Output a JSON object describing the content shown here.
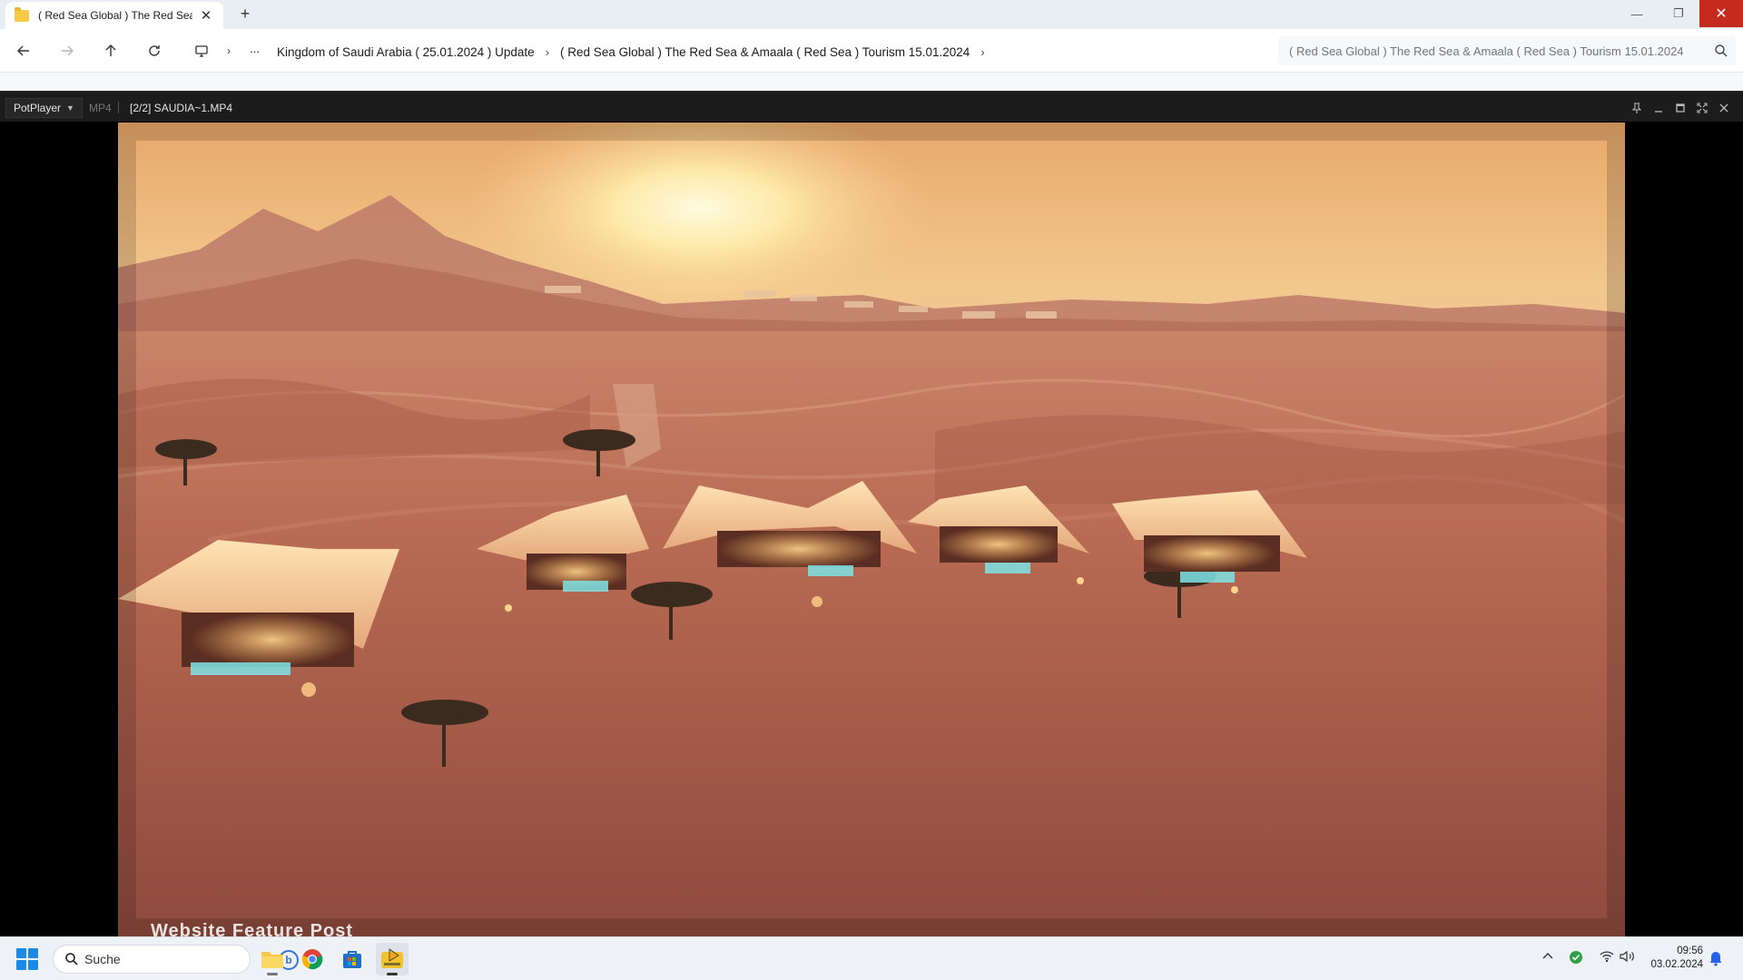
{
  "explorer": {
    "tab_title": "( Red Sea Global ) The Red Sea & Amaala ( Red Sea ) Tourism 15.01.2024",
    "breadcrumb": [
      "Kingdom of Saudi Arabia ( 25.01.2024 ) Update",
      "( Red Sea Global ) The Red Sea & Amaala ( Red Sea ) Tourism 15.01.2024"
    ],
    "search_placeholder": "( Red Sea Global ) The Red Sea & Amaala ( Red Sea ) Tourism 15.01.2024",
    "icons": {
      "back": "arrow-left-icon",
      "forward": "arrow-right-icon",
      "up": "arrow-up-icon",
      "refresh": "refresh-icon",
      "pc": "monitor-icon",
      "more": "ellipsis-icon",
      "search": "search-icon"
    }
  },
  "player": {
    "app_name": "PotPlayer",
    "format": "MP4",
    "file": "[2/2] SAUDIA~1.MP4",
    "caption": "Website Feature Post",
    "video_description_colors": {
      "sky_top": "#f4b870",
      "sky_glow": "#fff6c8",
      "sand": "#b8694c",
      "sand_shadow": "#7c3a2e",
      "tent": "#f2c79a",
      "pool": "#7fe3e6"
    }
  },
  "taskbar": {
    "search_label": "Suche",
    "time": "09:56",
    "date": "03.02.2024",
    "apps": [
      "file-explorer-icon",
      "chrome-icon",
      "store-icon",
      "potplayer-icon"
    ]
  }
}
